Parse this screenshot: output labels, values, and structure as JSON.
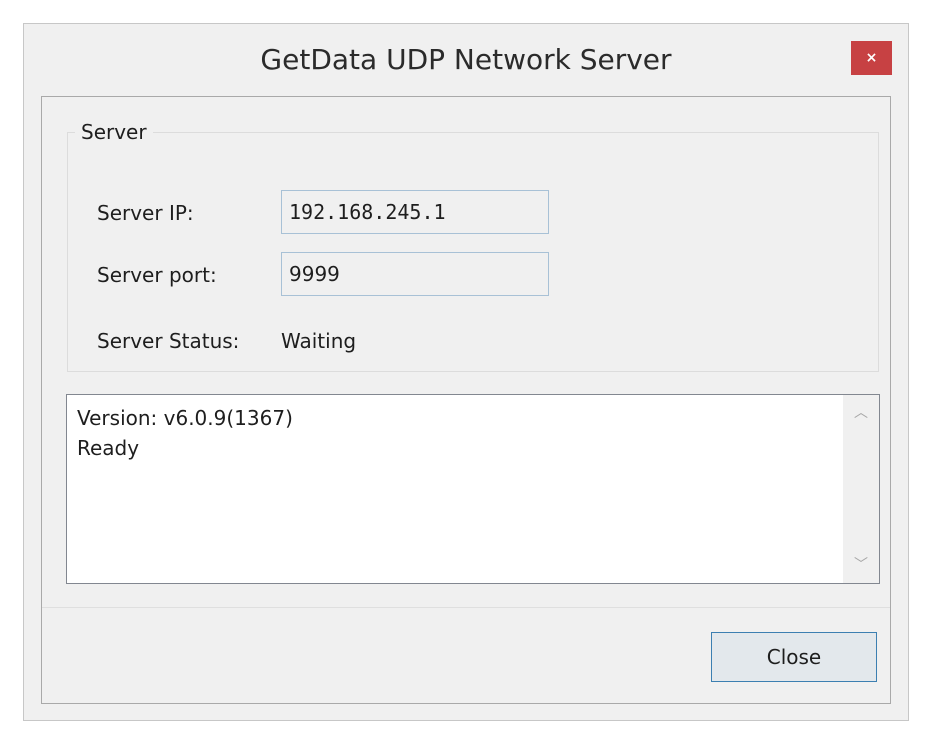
{
  "window": {
    "title": "GetData UDP Network Server",
    "close_glyph": "×"
  },
  "server_group": {
    "legend": "Server",
    "ip_label": "Server IP:",
    "ip_value": "192.168.245.1",
    "port_label": "Server port:",
    "port_value": "9999",
    "status_label": "Server Status:",
    "status_value": "Waiting"
  },
  "log": {
    "lines": [
      "Version: v6.0.9(1367)",
      "Ready"
    ],
    "scroll_up_glyph": "︿",
    "scroll_down_glyph": "﹀"
  },
  "footer": {
    "close_label": "Close"
  },
  "colors": {
    "title_close_bg": "#c74143",
    "button_border": "#3c7fb1",
    "window_bg": "#f0f0f0"
  }
}
